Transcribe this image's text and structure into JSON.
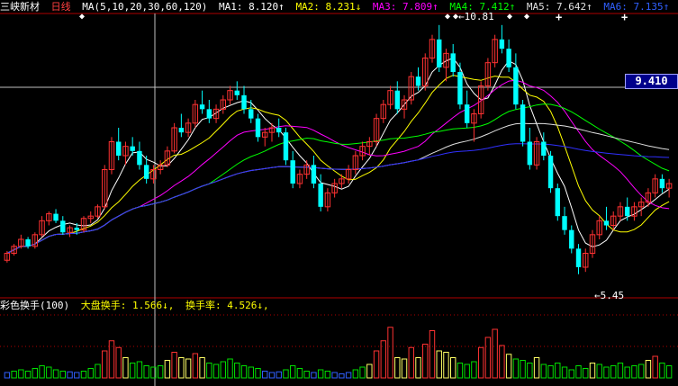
{
  "header": {
    "stock_name": "三峡新材",
    "period": "日线",
    "ma_params": "MA(5,10,20,30,60,120)",
    "ma1": "MA1: 8.120↑",
    "ma2": "MA2: 8.231↓",
    "ma3": "MA3: 7.809↑",
    "ma4": "MA4: 7.412↑",
    "ma5": "MA5: 7.642↑",
    "ma6": "MA6: 7.135↑"
  },
  "current_price": "9.410",
  "annotations": {
    "high": "10.81",
    "low": "5.45"
  },
  "volume_header": {
    "indicator": "彩色换手(100)",
    "market_turnover": "大盘换手: 1.566↓,",
    "turnover_rate": "换手率: 4.526↓,"
  },
  "colors": {
    "up": "#ff3232",
    "down": "#00ffff",
    "ma1": "#ffffff",
    "ma2": "#ffff00",
    "ma3": "#ff00ff",
    "ma4": "#00ff00",
    "ma5": "#e0e0e0",
    "ma6": "#3030ff",
    "grid": "#b00000",
    "crosshair": "#c0c0c0",
    "vol_red": "#ff3232",
    "vol_green": "#00e000",
    "vol_yellow": "#ffff66",
    "vol_blue": "#3060ff"
  },
  "chart_data": {
    "type": "candlestick",
    "price_range": [
      5.0,
      11.0
    ],
    "candles": [
      [
        5.75,
        5.95,
        5.7,
        5.9
      ],
      [
        5.9,
        6.1,
        5.85,
        6.05
      ],
      [
        6.05,
        6.3,
        6.0,
        6.2
      ],
      [
        6.2,
        6.25,
        6.0,
        6.05
      ],
      [
        6.05,
        6.35,
        6.0,
        6.3
      ],
      [
        6.3,
        6.7,
        6.25,
        6.6
      ],
      [
        6.6,
        6.8,
        6.5,
        6.75
      ],
      [
        6.75,
        6.85,
        6.55,
        6.6
      ],
      [
        6.6,
        6.7,
        6.3,
        6.35
      ],
      [
        6.35,
        6.5,
        6.25,
        6.45
      ],
      [
        6.45,
        6.55,
        6.3,
        6.4
      ],
      [
        6.4,
        6.7,
        6.35,
        6.65
      ],
      [
        6.65,
        6.8,
        6.55,
        6.7
      ],
      [
        6.7,
        6.95,
        6.65,
        6.9
      ],
      [
        6.9,
        7.8,
        6.85,
        7.7
      ],
      [
        7.7,
        8.4,
        7.6,
        8.3
      ],
      [
        8.3,
        8.6,
        7.9,
        8.0
      ],
      [
        8.0,
        8.3,
        7.8,
        8.2
      ],
      [
        8.2,
        8.4,
        8.0,
        8.1
      ],
      [
        8.1,
        8.3,
        7.7,
        7.8
      ],
      [
        7.8,
        8.0,
        7.4,
        7.5
      ],
      [
        7.5,
        7.8,
        7.4,
        7.7
      ],
      [
        7.7,
        7.9,
        7.6,
        7.8
      ],
      [
        7.8,
        8.2,
        7.75,
        8.1
      ],
      [
        8.1,
        8.7,
        8.05,
        8.6
      ],
      [
        8.6,
        8.9,
        8.4,
        8.5
      ],
      [
        8.5,
        8.8,
        8.4,
        8.7
      ],
      [
        8.7,
        9.2,
        8.6,
        9.1
      ],
      [
        9.1,
        9.4,
        8.9,
        9.0
      ],
      [
        9.0,
        9.2,
        8.7,
        8.8
      ],
      [
        8.8,
        9.1,
        8.7,
        9.0
      ],
      [
        9.0,
        9.3,
        8.9,
        9.2
      ],
      [
        9.2,
        9.5,
        9.1,
        9.4
      ],
      [
        9.4,
        9.6,
        9.2,
        9.3
      ],
      [
        9.3,
        9.5,
        8.9,
        9.0
      ],
      [
        9.0,
        9.2,
        8.7,
        8.8
      ],
      [
        8.8,
        8.9,
        8.3,
        8.4
      ],
      [
        8.4,
        8.6,
        8.2,
        8.5
      ],
      [
        8.5,
        8.7,
        8.3,
        8.6
      ],
      [
        8.6,
        8.8,
        8.4,
        8.5
      ],
      [
        8.5,
        8.6,
        7.8,
        7.9
      ],
      [
        7.9,
        8.1,
        7.3,
        7.4
      ],
      [
        7.4,
        7.7,
        7.3,
        7.6
      ],
      [
        7.6,
        7.9,
        7.5,
        7.8
      ],
      [
        7.8,
        8.0,
        7.3,
        7.4
      ],
      [
        7.4,
        7.6,
        6.8,
        6.9
      ],
      [
        6.9,
        7.3,
        6.8,
        7.2
      ],
      [
        7.2,
        7.5,
        7.1,
        7.4
      ],
      [
        7.4,
        7.6,
        7.3,
        7.5
      ],
      [
        7.5,
        7.8,
        7.4,
        7.7
      ],
      [
        7.7,
        8.1,
        7.6,
        8.0
      ],
      [
        8.0,
        8.3,
        7.9,
        8.2
      ],
      [
        8.2,
        8.4,
        8.0,
        8.3
      ],
      [
        8.3,
        8.9,
        8.2,
        8.8
      ],
      [
        8.8,
        9.2,
        8.7,
        9.1
      ],
      [
        9.1,
        9.5,
        9.0,
        9.4
      ],
      [
        9.4,
        9.6,
        8.9,
        9.0
      ],
      [
        9.0,
        9.3,
        8.8,
        9.2
      ],
      [
        9.2,
        9.8,
        9.1,
        9.7
      ],
      [
        9.7,
        9.9,
        9.4,
        9.5
      ],
      [
        9.5,
        10.2,
        9.4,
        10.1
      ],
      [
        10.1,
        10.6,
        10.0,
        10.5
      ],
      [
        10.5,
        10.81,
        9.8,
        9.9
      ],
      [
        9.9,
        10.3,
        9.6,
        10.2
      ],
      [
        10.2,
        10.4,
        9.7,
        9.8
      ],
      [
        9.8,
        10.0,
        9.0,
        9.1
      ],
      [
        9.1,
        9.4,
        8.6,
        8.7
      ],
      [
        8.7,
        9.0,
        8.3,
        8.9
      ],
      [
        8.9,
        9.6,
        8.8,
        9.5
      ],
      [
        9.5,
        10.1,
        9.4,
        10.0
      ],
      [
        10.0,
        10.6,
        9.9,
        10.5
      ],
      [
        10.5,
        10.81,
        10.2,
        10.3
      ],
      [
        10.3,
        10.5,
        9.8,
        9.9
      ],
      [
        9.9,
        10.2,
        9.0,
        9.1
      ],
      [
        9.1,
        9.2,
        8.2,
        8.3
      ],
      [
        8.3,
        8.6,
        7.7,
        7.8
      ],
      [
        7.8,
        8.4,
        7.7,
        8.3
      ],
      [
        8.3,
        8.5,
        7.9,
        8.0
      ],
      [
        8.0,
        8.1,
        7.2,
        7.3
      ],
      [
        7.3,
        7.4,
        6.6,
        6.7
      ],
      [
        6.7,
        6.9,
        6.3,
        6.4
      ],
      [
        6.4,
        6.5,
        5.9,
        6.0
      ],
      [
        6.0,
        6.1,
        5.45,
        5.6
      ],
      [
        5.6,
        6.0,
        5.5,
        5.9
      ],
      [
        5.9,
        6.4,
        5.8,
        6.3
      ],
      [
        6.3,
        6.7,
        6.2,
        6.6
      ],
      [
        6.6,
        6.9,
        6.4,
        6.5
      ],
      [
        6.5,
        6.8,
        6.4,
        6.7
      ],
      [
        6.7,
        7.0,
        6.6,
        6.9
      ],
      [
        6.9,
        7.1,
        6.6,
        6.7
      ],
      [
        6.7,
        7.0,
        6.6,
        6.9
      ],
      [
        6.9,
        7.1,
        6.7,
        7.0
      ],
      [
        7.0,
        7.3,
        6.9,
        7.2
      ],
      [
        7.2,
        7.6,
        7.1,
        7.5
      ],
      [
        7.5,
        7.6,
        7.2,
        7.3
      ],
      [
        7.3,
        7.5,
        7.1,
        7.4
      ]
    ],
    "volume_max": 100,
    "volumes": [
      [
        8,
        "blue"
      ],
      [
        10,
        "green"
      ],
      [
        12,
        "green"
      ],
      [
        10,
        "green"
      ],
      [
        14,
        "green"
      ],
      [
        18,
        "green"
      ],
      [
        16,
        "green"
      ],
      [
        12,
        "green"
      ],
      [
        10,
        "green"
      ],
      [
        9,
        "blue"
      ],
      [
        8,
        "blue"
      ],
      [
        10,
        "green"
      ],
      [
        14,
        "green"
      ],
      [
        20,
        "green"
      ],
      [
        40,
        "red"
      ],
      [
        55,
        "red"
      ],
      [
        45,
        "red"
      ],
      [
        30,
        "yellow"
      ],
      [
        22,
        "green"
      ],
      [
        24,
        "green"
      ],
      [
        18,
        "green"
      ],
      [
        16,
        "green"
      ],
      [
        18,
        "green"
      ],
      [
        26,
        "yellow"
      ],
      [
        38,
        "red"
      ],
      [
        30,
        "yellow"
      ],
      [
        28,
        "yellow"
      ],
      [
        36,
        "red"
      ],
      [
        30,
        "yellow"
      ],
      [
        22,
        "green"
      ],
      [
        20,
        "green"
      ],
      [
        24,
        "green"
      ],
      [
        28,
        "green"
      ],
      [
        22,
        "green"
      ],
      [
        18,
        "green"
      ],
      [
        16,
        "green"
      ],
      [
        14,
        "green"
      ],
      [
        10,
        "blue"
      ],
      [
        8,
        "blue"
      ],
      [
        9,
        "blue"
      ],
      [
        12,
        "green"
      ],
      [
        18,
        "green"
      ],
      [
        14,
        "green"
      ],
      [
        10,
        "green"
      ],
      [
        8,
        "blue"
      ],
      [
        12,
        "green"
      ],
      [
        10,
        "green"
      ],
      [
        8,
        "blue"
      ],
      [
        6,
        "blue"
      ],
      [
        8,
        "blue"
      ],
      [
        12,
        "green"
      ],
      [
        16,
        "green"
      ],
      [
        20,
        "yellow"
      ],
      [
        40,
        "red"
      ],
      [
        55,
        "red"
      ],
      [
        75,
        "red"
      ],
      [
        30,
        "yellow"
      ],
      [
        28,
        "yellow"
      ],
      [
        45,
        "red"
      ],
      [
        30,
        "yellow"
      ],
      [
        50,
        "red"
      ],
      [
        70,
        "red"
      ],
      [
        40,
        "yellow"
      ],
      [
        38,
        "yellow"
      ],
      [
        30,
        "yellow"
      ],
      [
        22,
        "green"
      ],
      [
        20,
        "green"
      ],
      [
        24,
        "green"
      ],
      [
        45,
        "red"
      ],
      [
        60,
        "red"
      ],
      [
        72,
        "red"
      ],
      [
        48,
        "red"
      ],
      [
        35,
        "yellow"
      ],
      [
        28,
        "green"
      ],
      [
        26,
        "green"
      ],
      [
        22,
        "green"
      ],
      [
        30,
        "yellow"
      ],
      [
        20,
        "green"
      ],
      [
        18,
        "green"
      ],
      [
        22,
        "green"
      ],
      [
        16,
        "green"
      ],
      [
        12,
        "green"
      ],
      [
        18,
        "green"
      ],
      [
        14,
        "green"
      ],
      [
        22,
        "yellow"
      ],
      [
        20,
        "green"
      ],
      [
        16,
        "green"
      ],
      [
        18,
        "green"
      ],
      [
        22,
        "green"
      ],
      [
        16,
        "green"
      ],
      [
        18,
        "green"
      ],
      [
        20,
        "green"
      ],
      [
        26,
        "yellow"
      ],
      [
        32,
        "red"
      ],
      [
        22,
        "green"
      ],
      [
        18,
        "green"
      ]
    ]
  }
}
